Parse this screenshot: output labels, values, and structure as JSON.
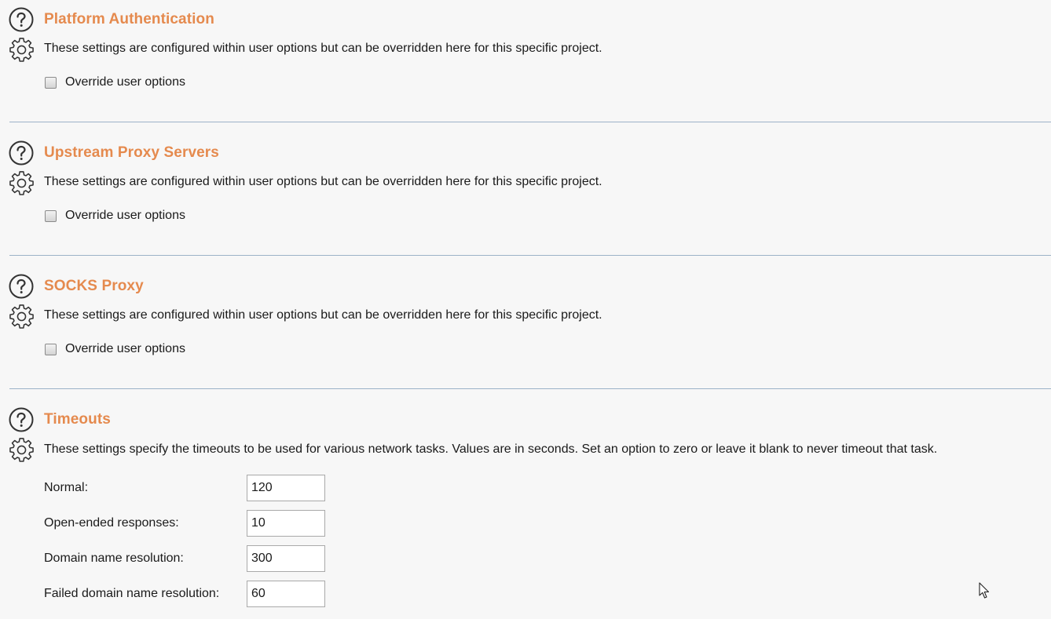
{
  "sections": [
    {
      "title": "Platform Authentication",
      "description": "These settings are configured within user options but can be overridden here for this specific project.",
      "override_label": "Override user options",
      "override_checked": false
    },
    {
      "title": "Upstream Proxy Servers",
      "description": "These settings are configured within user options but can be overridden here for this specific project.",
      "override_label": "Override user options",
      "override_checked": false
    },
    {
      "title": "SOCKS Proxy",
      "description": "These settings are configured within user options but can be overridden here for this specific project.",
      "override_label": "Override user options",
      "override_checked": false
    }
  ],
  "timeouts": {
    "title": "Timeouts",
    "description": "These settings specify the timeouts to be used for various network tasks. Values are in seconds. Set an option to zero or leave it blank to never timeout that task.",
    "fields": [
      {
        "label": "Normal:",
        "value": "120"
      },
      {
        "label": "Open-ended responses:",
        "value": "10"
      },
      {
        "label": "Domain name resolution:",
        "value": "300"
      },
      {
        "label": "Failed domain name resolution:",
        "value": "60"
      }
    ]
  },
  "icons": {
    "help": "help-icon",
    "settings": "gear-icon",
    "cursor": "mouse-pointer-icon"
  },
  "colors": {
    "title": "#e58a4e",
    "divider": "#9cb2c8",
    "background": "#f7f7f7"
  }
}
